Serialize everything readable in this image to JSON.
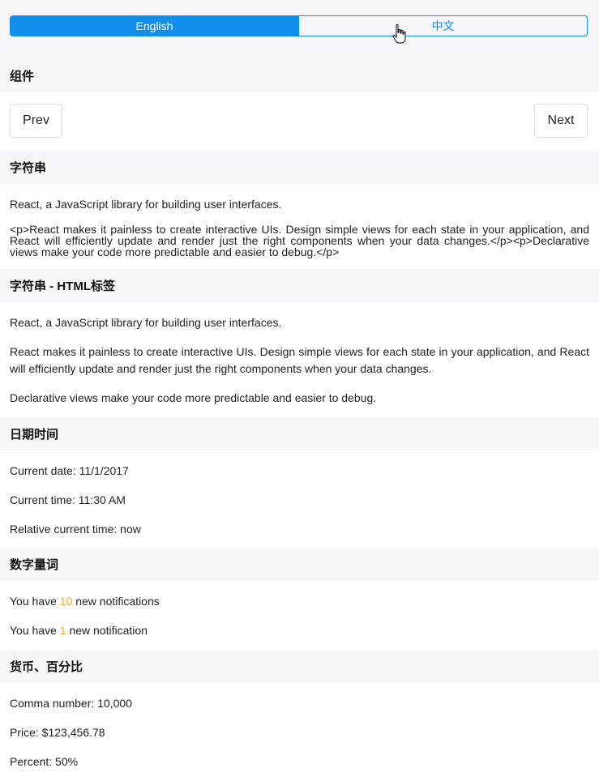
{
  "language_switch": {
    "options": [
      "English",
      "中文"
    ],
    "selected": "English"
  },
  "sections": {
    "components": {
      "title": "组件",
      "prev_label": "Prev",
      "next_label": "Next"
    },
    "string": {
      "title": "字符串",
      "line1": "React, a JavaScript library for building user interfaces.",
      "raw_html": "<p>React makes it painless to create interactive UIs. Design simple views for each state in your application, and React will efficiently update and render just the right components when your data changes.</p><p>Declarative views make your code more predictable and easier to debug.</p>"
    },
    "string_html": {
      "title": "字符串 - HTML标签",
      "line1": "React, a JavaScript library for building user interfaces.",
      "para1": "React makes it painless to create interactive UIs. Design simple views for each state in your application, and React will efficiently update and render just the right components when your data changes.",
      "para2": "Declarative views make your code more predictable and easier to debug."
    },
    "datetime": {
      "title": "日期时间",
      "current_date": "Current date: 11/1/2017",
      "current_time": "Current time: 11:30 AM",
      "relative_time": "Relative current time: now"
    },
    "plural": {
      "title": "数字量词",
      "line1_prefix": "You have ",
      "line1_count": "10",
      "line1_suffix": " new notifications",
      "line2_prefix": "You have ",
      "line2_count": "1",
      "line2_suffix": " new notification"
    },
    "currency": {
      "title": "货币、百分比",
      "comma": "Comma number: 10,000",
      "price": "Price: $123,456.78",
      "percent": "Percent: 50%"
    }
  },
  "colors": {
    "accent": "#108ee9",
    "highlight": "#f5a623",
    "section_bg": "#f5f5f9"
  }
}
